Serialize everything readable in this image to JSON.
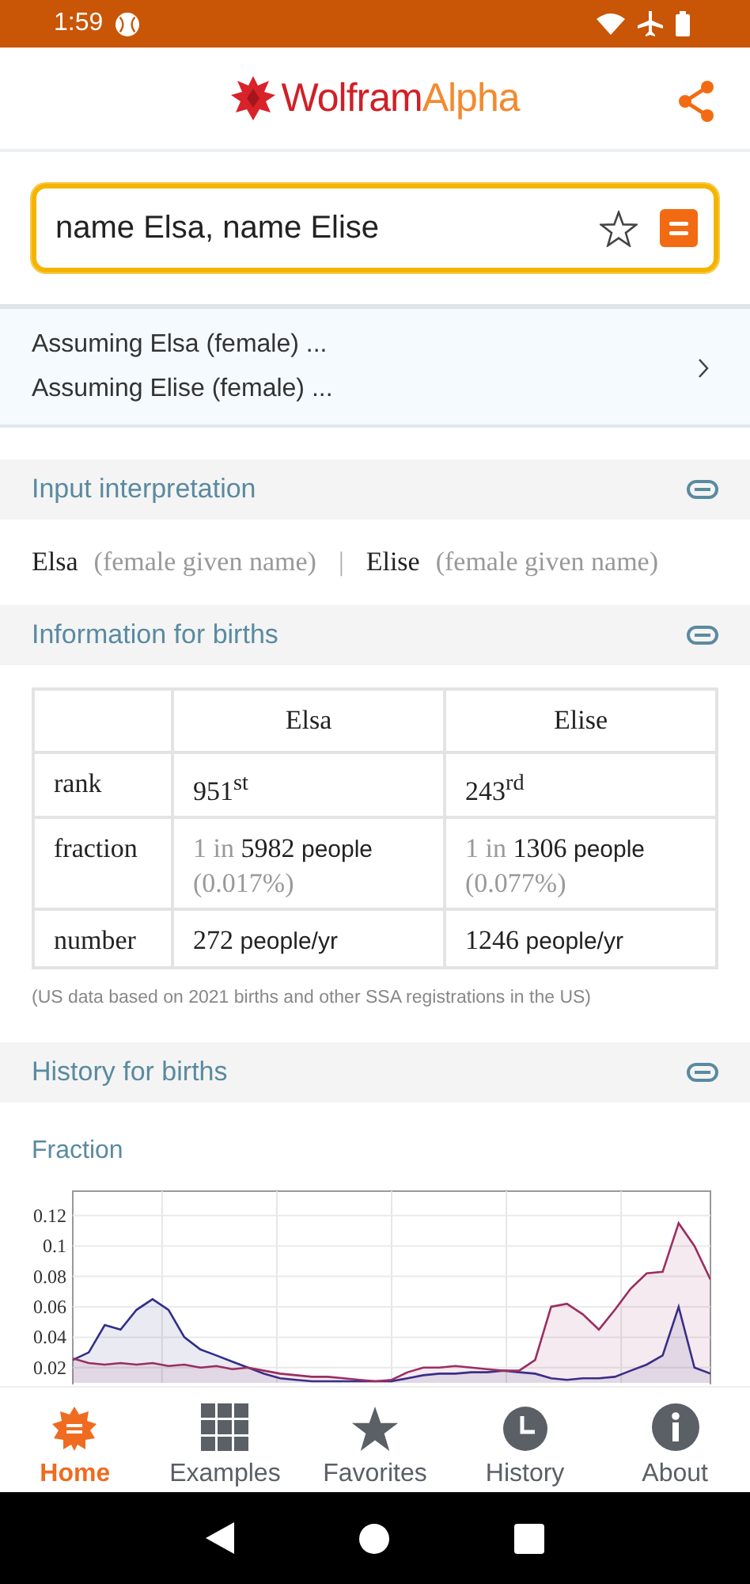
{
  "status_bar": {
    "time": "1:59"
  },
  "header": {
    "logo": [
      "Wolfram",
      "Alpha"
    ]
  },
  "search": {
    "value": "name Elsa, name Elise"
  },
  "assumptions": [
    "Assuming Elsa (female) ...",
    "Assuming Elise (female) ..."
  ],
  "pods": [
    {
      "kind": "interpretation",
      "title": "Input interpretation",
      "items": [
        {
          "name": "Elsa",
          "note": "(female given name)"
        },
        {
          "name": "Elise",
          "note": "(female given name)"
        }
      ],
      "separator": "|"
    },
    {
      "kind": "table",
      "title": "Information for births",
      "columns": [
        "Elsa",
        "Elise"
      ],
      "rows": [
        {
          "label": "rank",
          "cells": [
            {
              "kind": "rank",
              "text": "951$^{st}$"
            },
            {
              "kind": "rank",
              "text": "243$^{rd}$"
            }
          ]
        },
        {
          "label": "fraction",
          "cells": [
            {
              "kind": "fraction",
              "prefix": "1 in",
              "value": "5982",
              "unit": "people",
              "percent": "(0.017%)"
            },
            {
              "kind": "fraction",
              "prefix": "1 in",
              "value": "1306",
              "unit": "people",
              "percent": "(0.077%)"
            }
          ]
        },
        {
          "label": "number",
          "cells": [
            {
              "kind": "number",
              "value": "272",
              "unit": "people/yr"
            },
            {
              "kind": "number",
              "value": "1246",
              "unit": "people/yr"
            }
          ]
        }
      ],
      "note": "(US data based on 2021 births and other SSA registrations in the US)"
    },
    {
      "kind": "chart",
      "title": "History for births",
      "chart_data": {
        "type": "area",
        "title": "Fraction",
        "grid": true,
        "ylim": [
          0.01,
          0.136
        ],
        "yticks": [
          0.02,
          0.04,
          0.06,
          0.08,
          0.1,
          0.12
        ],
        "series": [
          {
            "color": "#2e2e8c",
            "values": [
              0.025,
              0.03,
              0.048,
              0.045,
              0.058,
              0.065,
              0.058,
              0.04,
              0.032,
              0.028,
              0.024,
              0.02,
              0.016,
              0.013,
              0.012,
              0.011,
              0.011,
              0.011,
              0.011,
              0.011,
              0.011,
              0.013,
              0.015,
              0.016,
              0.016,
              0.017,
              0.017,
              0.018,
              0.017,
              0.016,
              0.013,
              0.012,
              0.013,
              0.013,
              0.014,
              0.018,
              0.022,
              0.028,
              0.06,
              0.02,
              0.016
            ]
          },
          {
            "color": "#9a2e62",
            "values": [
              0.026,
              0.023,
              0.022,
              0.023,
              0.022,
              0.023,
              0.021,
              0.022,
              0.02,
              0.021,
              0.019,
              0.02,
              0.018,
              0.016,
              0.015,
              0.014,
              0.014,
              0.013,
              0.012,
              0.011,
              0.012,
              0.017,
              0.02,
              0.02,
              0.021,
              0.02,
              0.019,
              0.018,
              0.018,
              0.025,
              0.06,
              0.062,
              0.055,
              0.045,
              0.058,
              0.072,
              0.082,
              0.083,
              0.115,
              0.1,
              0.078
            ]
          }
        ]
      }
    }
  ],
  "nav": [
    {
      "label": "Home",
      "selected": true
    },
    {
      "label": "Examples",
      "selected": false
    },
    {
      "label": "Favorites",
      "selected": false
    },
    {
      "label": "History",
      "selected": false
    },
    {
      "label": "About",
      "selected": false
    }
  ]
}
